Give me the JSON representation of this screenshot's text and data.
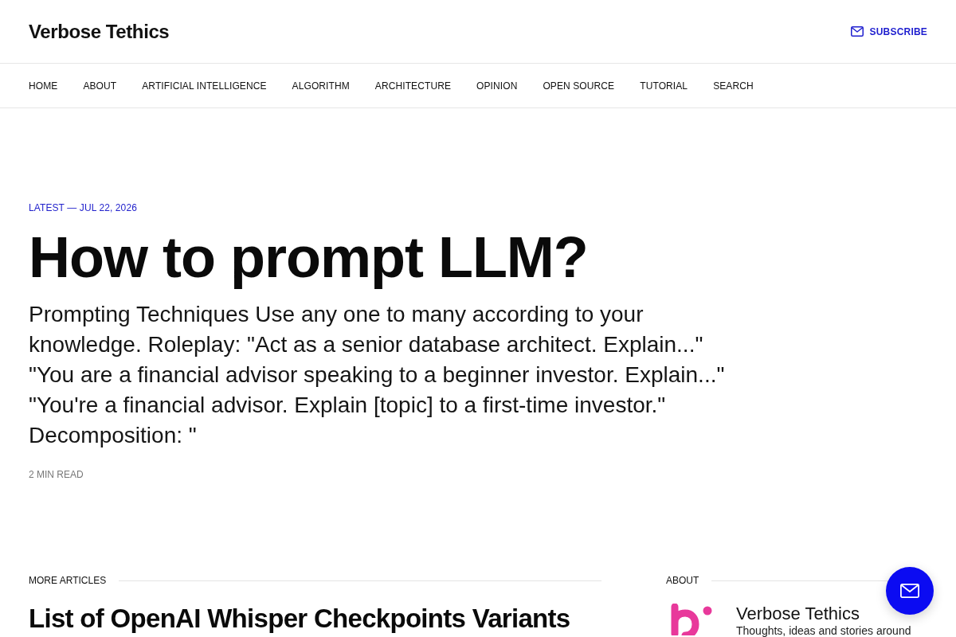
{
  "header": {
    "site_title": "Verbose Tethics",
    "subscribe": "SUBSCRIBE"
  },
  "nav": {
    "items": [
      "HOME",
      "ABOUT",
      "ARTIFICIAL INTELLIGENCE",
      "ALGORITHM",
      "ARCHITECTURE",
      "OPINION",
      "OPEN SOURCE",
      "TUTORIAL",
      "SEARCH"
    ]
  },
  "hero": {
    "kicker": "LATEST — JUL 22, 2026",
    "title": "How to prompt LLM?",
    "excerpt": "Prompting Techniques Use any one to many according to your knowledge. Roleplay: \"Act as a senior database architect. Explain...\" \"You are a financial advisor speaking to a beginner investor. Explain...\" \"You're a financial advisor. Explain [topic] to a first-time investor.\" Decomposition: \"",
    "read_time": "2 MIN READ"
  },
  "more_articles": {
    "heading": "MORE ARTICLES",
    "articles": [
      {
        "title": "List of OpenAI Whisper Checkpoints Variants"
      }
    ]
  },
  "sidebar": {
    "heading": "ABOUT",
    "site_name": "Verbose Tethics",
    "description": "Thoughts, ideas and stories around"
  }
}
